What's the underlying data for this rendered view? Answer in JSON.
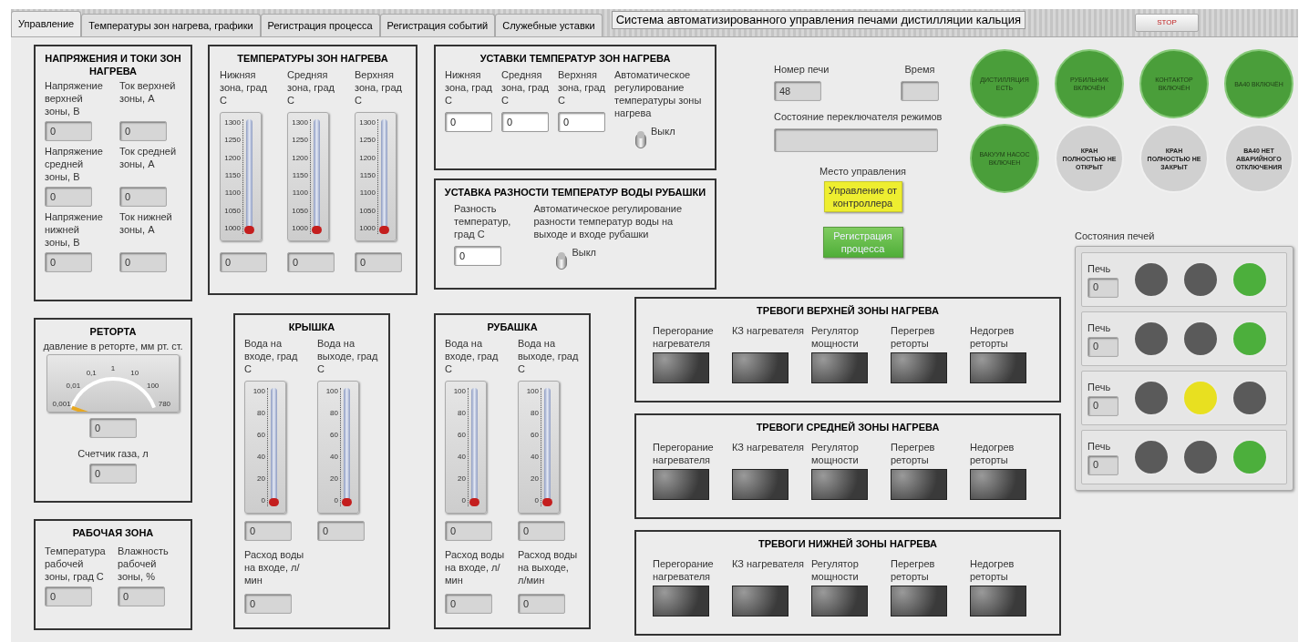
{
  "tabs": [
    {
      "label": "Управление",
      "selected": true
    },
    {
      "label": "Температуры зон нагрева, графики",
      "selected": false
    },
    {
      "label": "Регистрация процесса",
      "selected": false
    },
    {
      "label": "Регистрация событий",
      "selected": false
    },
    {
      "label": "Служебные уставки",
      "selected": false
    }
  ],
  "title": "Система автоматизированного управления печами дистилляции кальция",
  "stop_button": "STOP",
  "voltages_panel": {
    "title": "НАПРЯЖЕНИЯ И ТОКИ ЗОН НАГРЕВА",
    "fields": [
      {
        "label": "Напряжение верхней зоны, В",
        "value": "0"
      },
      {
        "label": "Ток верхней зоны, А",
        "value": "0"
      },
      {
        "label": "Напряжение средней зоны, В",
        "value": "0"
      },
      {
        "label": "Ток средней зоны, А",
        "value": "0"
      },
      {
        "label": "Напряжение нижней зоны, В",
        "value": "0"
      },
      {
        "label": "Ток нижней зоны, А",
        "value": "0"
      }
    ]
  },
  "zone_temps": {
    "title": "ТЕМПЕРАТУРЫ ЗОН НАГРЕВА",
    "gauges": [
      {
        "label": "Нижняя зона, град С",
        "scale": [
          "1300",
          "1250",
          "1200",
          "1150",
          "1100",
          "1050",
          "1000"
        ],
        "level": 0,
        "value": "0"
      },
      {
        "label": "Средняя зона, град С",
        "scale": [
          "1300",
          "1250",
          "1200",
          "1150",
          "1100",
          "1050",
          "1000"
        ],
        "level": 0,
        "value": "0"
      },
      {
        "label": "Верхняя зона, град С",
        "scale": [
          "1300",
          "1250",
          "1200",
          "1150",
          "1100",
          "1050",
          "1000"
        ],
        "level": 0,
        "value": "0"
      }
    ]
  },
  "setpoints": {
    "title": "УСТАВКИ ТЕМПЕРАТУР ЗОН НАГРЕВА",
    "inputs": [
      {
        "label": "Нижняя зона, град С",
        "value": "0"
      },
      {
        "label": "Средняя зона, град С",
        "value": "0"
      },
      {
        "label": "Верхняя зона, град С",
        "value": "0"
      }
    ],
    "switch": {
      "label": "Автоматическое регулирование температуры зоны нагрева",
      "state_text": "Выкл",
      "on": false
    }
  },
  "jacket_setpoint": {
    "title": "УСТАВКА РАЗНОСТИ ТЕМПЕРАТУР ВОДЫ РУБАШКИ",
    "input": {
      "label": "Разность температур, град С",
      "value": "0"
    },
    "switch": {
      "label": "Автоматическое регулирование разности температур воды на выходе и входе рубашки",
      "state_text": "Выкл",
      "on": false
    }
  },
  "retort": {
    "title": "РЕТОРТА",
    "gauge_label": "давление в реторте, мм рт. ст.",
    "gauge_ticks": [
      "0,001",
      "0,01",
      "0,1",
      "1",
      "10",
      "100",
      "780"
    ],
    "pressure_value": "0",
    "gas_label": "Счетчик газа, л",
    "gas_value": "0"
  },
  "work_zone": {
    "title": "РАБОЧАЯ ЗОНА",
    "fields": [
      {
        "label": "Температура рабочей зоны, град С",
        "value": "0"
      },
      {
        "label": "Влажность рабочей зоны, %",
        "value": "0"
      }
    ]
  },
  "lid": {
    "title": "КРЫШКА",
    "gauges": [
      {
        "label": "Вода на входе, град С",
        "scale": [
          "100",
          "80",
          "60",
          "40",
          "20",
          "0"
        ],
        "level": 0,
        "value": "0"
      },
      {
        "label": "Вода на выходе, град С",
        "scale": [
          "100",
          "80",
          "60",
          "40",
          "20",
          "0"
        ],
        "level": 0,
        "value": "0"
      }
    ],
    "flows": [
      {
        "label": "Расход воды на входе, л/мин",
        "value": "0"
      }
    ]
  },
  "jacket": {
    "title": "РУБАШКА",
    "gauges": [
      {
        "label": "Вода на входе, град С",
        "scale": [
          "100",
          "80",
          "60",
          "40",
          "20",
          "0"
        ],
        "level": 0,
        "value": "0"
      },
      {
        "label": "Вода на выходе, град С",
        "scale": [
          "100",
          "80",
          "60",
          "40",
          "20",
          "0"
        ],
        "level": 0,
        "value": "0"
      }
    ],
    "flows": [
      {
        "label": "Расход воды на входе, л/мин",
        "value": "0"
      },
      {
        "label": "Расход воды на выходе, л/мин",
        "value": "0"
      }
    ]
  },
  "furnace_number": {
    "label": "Номер печи",
    "value": "48"
  },
  "time": {
    "label": "Время"
  },
  "mode_switch_state": {
    "label": "Состояние переключателя режимов"
  },
  "control_place": {
    "label": "Место управления",
    "button": "Управление от контроллера"
  },
  "registration_button": "Регистрация процесса",
  "status_lamps": [
    {
      "text": "ДИСТИЛЛЯЦИЯ ЕСТЬ",
      "on": true
    },
    {
      "text": "РУБИЛЬНИК ВКЛЮЧЁН",
      "on": true
    },
    {
      "text": "КОНТАКТОР ВКЛЮЧЁН",
      "on": true
    },
    {
      "text": "ВА40 ВКЛЮЧЁН",
      "on": true
    },
    {
      "text": "ВАКУУМ НАСОС ВКЛЮЧЕН",
      "on": true
    },
    {
      "text": "КРАН ПОЛНОСТЬЮ НЕ ОТКРЫТ",
      "on": false
    },
    {
      "text": "КРАН ПОЛНОСТЬЮ НЕ ЗАКРЫТ",
      "on": false
    },
    {
      "text": "ВА40 НЕТ АВАРИЙНОГО ОТКЛЮЧЕНИЯ",
      "on": false
    }
  ],
  "alarm_groups": [
    {
      "title": "ТРЕВОГИ ВЕРХНЕЙ ЗОНЫ НАГРЕВА",
      "alarms": [
        {
          "label": "Перегорание нагревателя",
          "on": false
        },
        {
          "label": "КЗ нагревателя",
          "on": false
        },
        {
          "label": "Регулятор мощности",
          "on": false
        },
        {
          "label": "Перегрев реторты",
          "on": false
        },
        {
          "label": "Недогрев реторты",
          "on": false
        }
      ]
    },
    {
      "title": "ТРЕВОГИ СРЕДНЕЙ ЗОНЫ НАГРЕВА",
      "alarms": [
        {
          "label": "Перегорание нагревателя",
          "on": false
        },
        {
          "label": "КЗ нагревателя",
          "on": false
        },
        {
          "label": "Регулятор мощности",
          "on": false
        },
        {
          "label": "Перегрев реторты",
          "on": false
        },
        {
          "label": "Недогрев реторты",
          "on": false
        }
      ]
    },
    {
      "title": "ТРЕВОГИ НИЖНЕЙ ЗОНЫ НАГРЕВА",
      "alarms": [
        {
          "label": "Перегорание нагревателя",
          "on": false
        },
        {
          "label": "КЗ нагревателя",
          "on": false
        },
        {
          "label": "Регулятор мощности",
          "on": false
        },
        {
          "label": "Перегрев реторты",
          "on": false
        },
        {
          "label": "Недогрев реторты",
          "on": false
        }
      ]
    }
  ],
  "furnace_states": {
    "title": "Состояния печей",
    "rows": [
      {
        "label": "Печь",
        "value": "0",
        "lamps": [
          {
            "color": "#5a5a5a"
          },
          {
            "color": "#5a5a5a"
          },
          {
            "color": "#4caf3c"
          }
        ]
      },
      {
        "label": "Печь",
        "value": "0",
        "lamps": [
          {
            "color": "#5a5a5a"
          },
          {
            "color": "#5a5a5a"
          },
          {
            "color": "#4caf3c"
          }
        ]
      },
      {
        "label": "Печь",
        "value": "0",
        "lamps": [
          {
            "color": "#5a5a5a"
          },
          {
            "color": "#e8e020"
          },
          {
            "color": "#5a5a5a"
          }
        ]
      },
      {
        "label": "Печь",
        "value": "0",
        "lamps": [
          {
            "color": "#5a5a5a"
          },
          {
            "color": "#5a5a5a"
          },
          {
            "color": "#4caf3c"
          }
        ]
      }
    ]
  }
}
